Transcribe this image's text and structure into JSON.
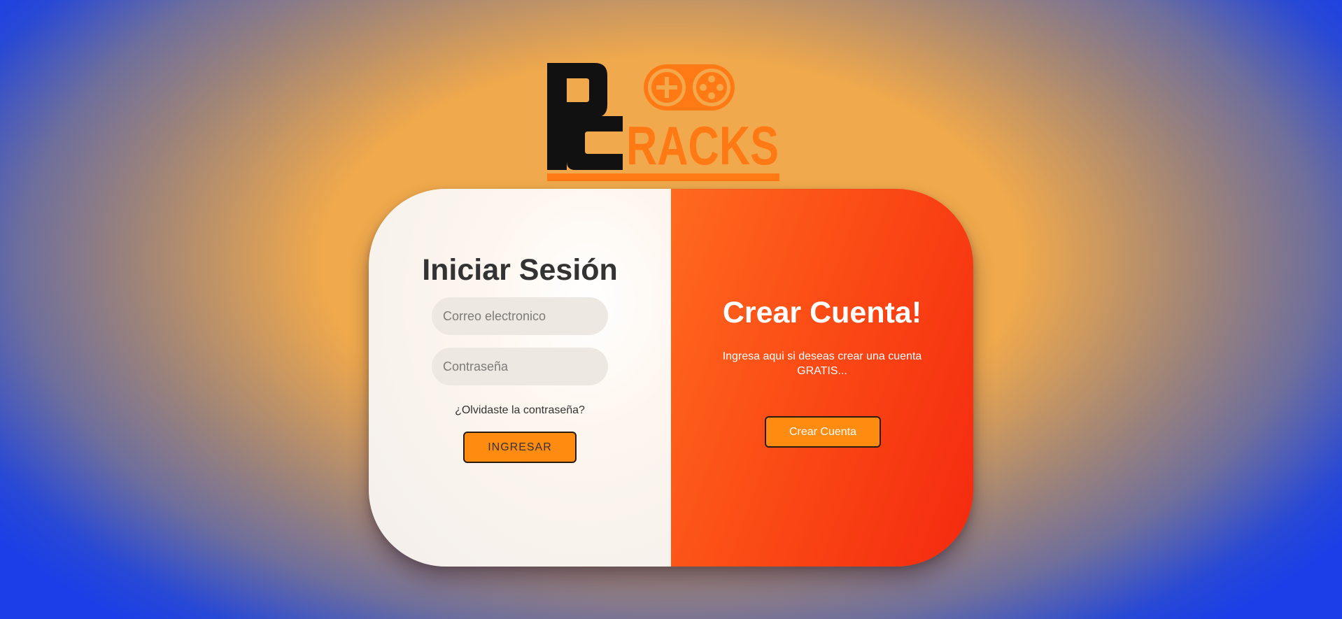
{
  "brand": {
    "logo_text": "PCRACKS",
    "logo_icon": "gamepad-icon",
    "colors": {
      "orange": "#ff7a14",
      "black": "#111111"
    }
  },
  "login": {
    "title": "Iniciar Sesión",
    "email_placeholder": "Correo electronico",
    "password_placeholder": "Contraseña",
    "forgot_link": "¿Olvidaste la contraseña?",
    "submit_label": "INGRESAR"
  },
  "signup": {
    "title": "Crear Cuenta!",
    "description": "Ingresa aqui si deseas crear una cuenta GRATIS...",
    "button_label": "Crear Cuenta"
  },
  "colors": {
    "accent_button": "#ff8b10",
    "signup_panel": "#fb4c15",
    "background_center": "#f0a94c",
    "background_edge": "#1a3ee8"
  }
}
